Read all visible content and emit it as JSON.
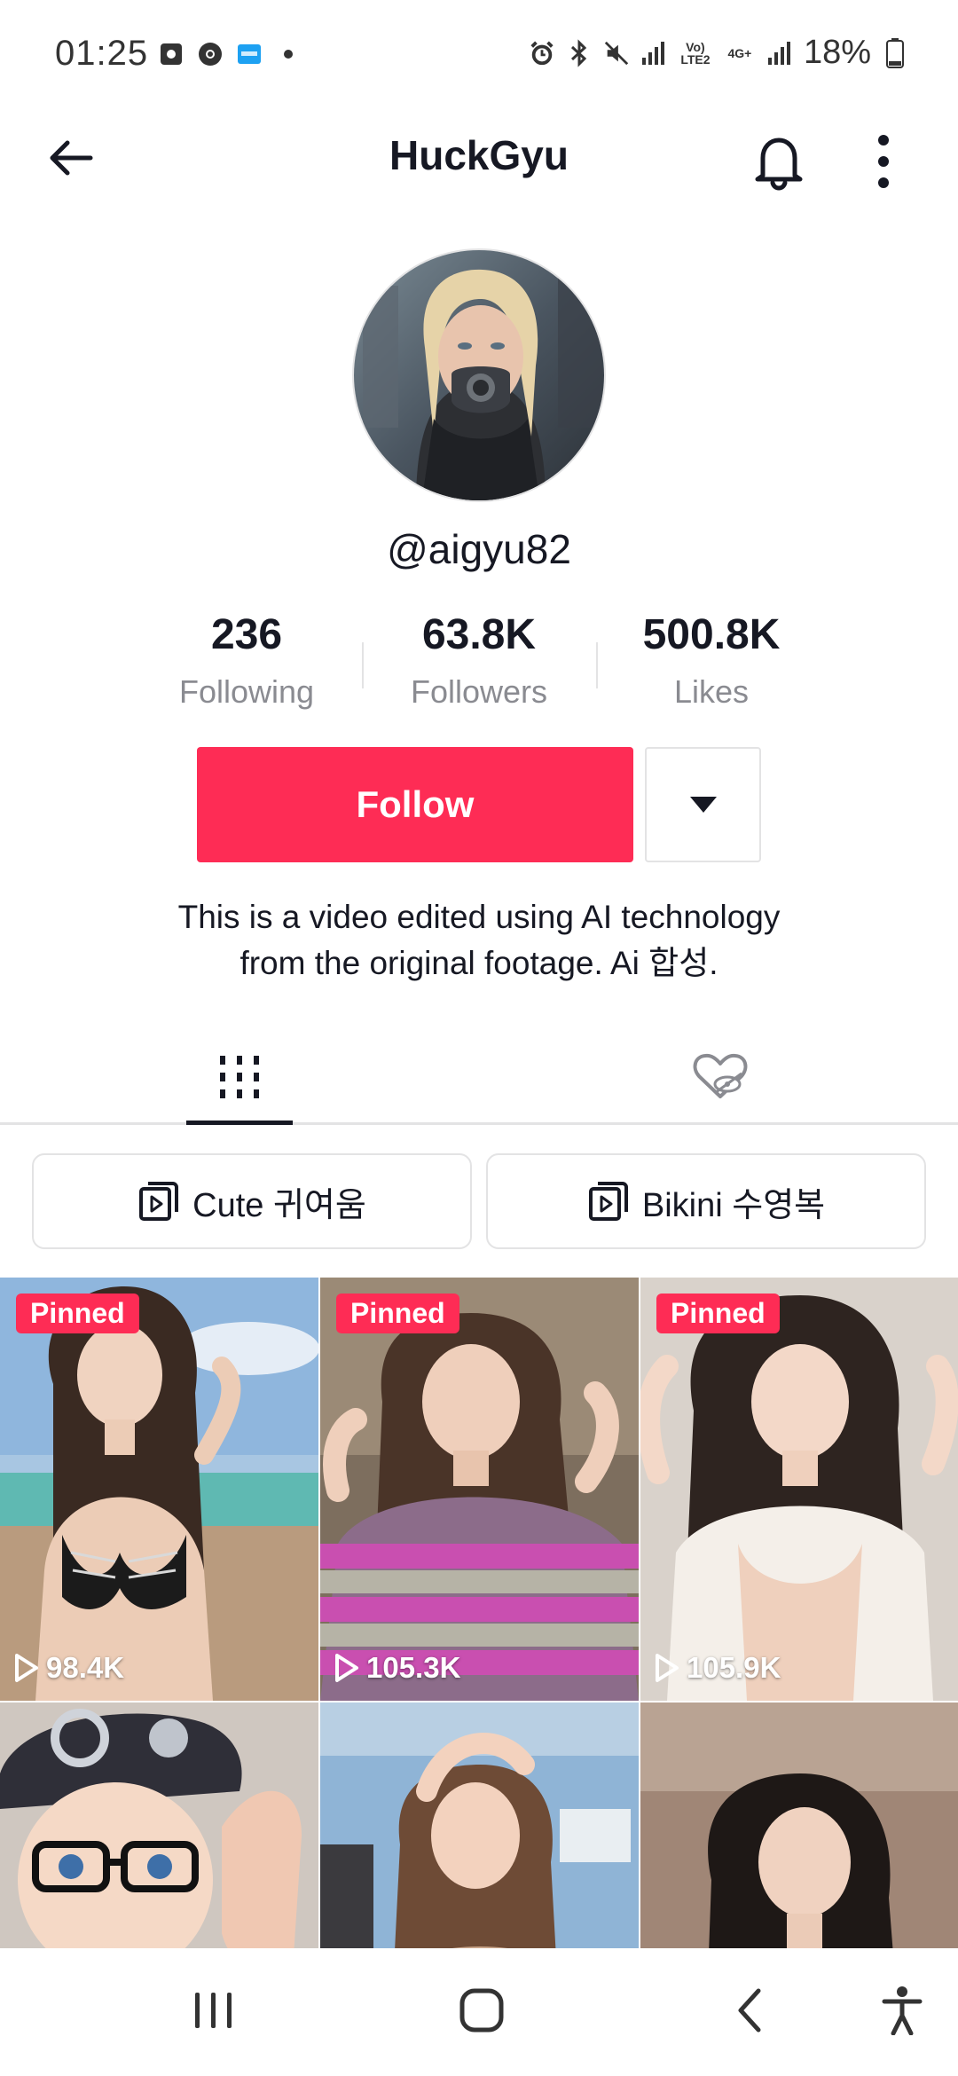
{
  "status_bar": {
    "time": "01:25",
    "battery": "18%",
    "network_1": "Vo) LTE2",
    "network_2": "4G+"
  },
  "header": {
    "title": "HuckGyu"
  },
  "profile": {
    "username": "@aigyu82",
    "stats": [
      {
        "value": "236",
        "label": "Following"
      },
      {
        "value": "63.8K",
        "label": "Followers"
      },
      {
        "value": "500.8K",
        "label": "Likes"
      }
    ],
    "follow_label": "Follow",
    "bio_line1": "This is a video edited using AI technology",
    "bio_line2": "from the original footage. Ai 합성."
  },
  "playlists": [
    {
      "label": "Cute 귀여움"
    },
    {
      "label": "Bikini 수영복"
    }
  ],
  "videos": [
    {
      "pinned": "Pinned",
      "views": "98.4K"
    },
    {
      "pinned": "Pinned",
      "views": "105.3K"
    },
    {
      "pinned": "Pinned",
      "views": "105.9K"
    },
    {
      "pinned": "",
      "views": ""
    },
    {
      "pinned": "",
      "views": ""
    },
    {
      "pinned": "",
      "views": ""
    }
  ],
  "colors": {
    "accent": "#fe2c55",
    "text": "#161823",
    "muted": "#8a8b91",
    "border": "#e3e3e4"
  }
}
